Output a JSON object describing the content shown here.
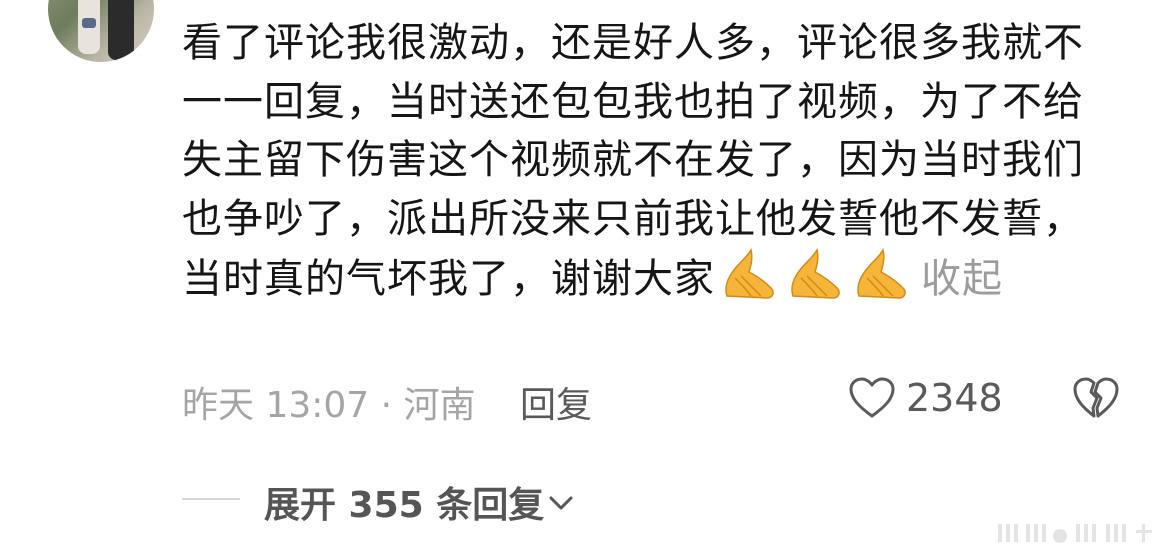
{
  "comment": {
    "avatar": "user-avatar-photo",
    "text": "看了评论我很激动，还是好人多，评论很多我就不一一回复，当时送还包包我也拍了视频，为了不给失主留下伤害这个视频就不在发了，因为当时我们也争吵了，派出所没来只前我让他发誓他不发誓，当时真的气坏我了，谢谢大家",
    "emoji_icons": [
      "praying-hands-emoji",
      "praying-hands-emoji",
      "praying-hands-emoji"
    ],
    "collapse_label": "收起",
    "time_location": "昨天 13:07 · 河南",
    "reply_label": "回复",
    "like_icon": "heart-outline-icon",
    "like_count": "2348",
    "dislike_icon": "broken-heart-icon"
  },
  "replies": {
    "expand_label": "展开 355 条回复",
    "expand_icon": "chevron-down-icon"
  },
  "colors": {
    "text": "#161616",
    "muted": "#a5a5a5",
    "action": "#5a5a5a",
    "emoji": "#f5b43a"
  }
}
